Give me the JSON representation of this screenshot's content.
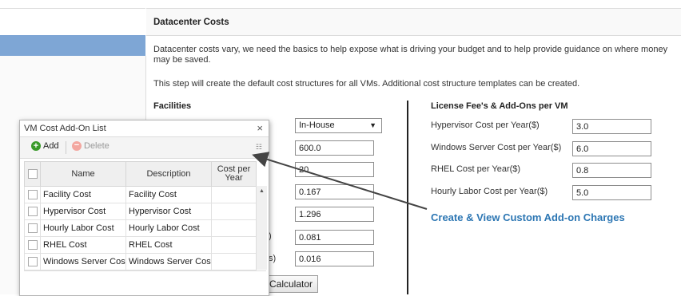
{
  "page": {
    "title": "Datacenter Costs",
    "intro_1": "Datacenter costs vary, we need the basics to help expose what is driving your budget and to help provide guidance on where money may be saved.",
    "intro_2": "This step will create the default cost structures for all VMs. Additional cost structure templates can be created."
  },
  "facilities": {
    "heading": "Facilities",
    "select_value": "In-House",
    "values": [
      "600.0",
      "20",
      "0.167",
      "1.296",
      "0.081",
      "0.016"
    ],
    "partial_label_1": ")",
    "partial_label_2": "s)",
    "calculator_label": "Calculator"
  },
  "license": {
    "heading": "License Fee's & Add-Ons per VM",
    "rows": [
      {
        "label": "Hypervisor Cost per Year($)",
        "value": "3.0"
      },
      {
        "label": "Windows Server Cost per Year($)",
        "value": "6.0"
      },
      {
        "label": "RHEL Cost per Year($)",
        "value": "0.8"
      },
      {
        "label": "Hourly Labor Cost per Year($)",
        "value": "5.0"
      }
    ],
    "link_text": "Create & View Custom Add-on Charges"
  },
  "popup": {
    "title": "VM Cost Add-On List",
    "close": "×",
    "add_label": "Add",
    "delete_label": "Delete",
    "columns": [
      "Name",
      "Description",
      "Cost per Year"
    ],
    "rows": [
      {
        "name": "Facility Cost",
        "description": "Facility Cost"
      },
      {
        "name": "Hypervisor Cost",
        "description": "Hypervisor Cost"
      },
      {
        "name": "Hourly Labor Cost",
        "description": "Hourly Labor Cost"
      },
      {
        "name": "RHEL Cost",
        "description": "RHEL Cost"
      },
      {
        "name": "Windows Server Cost",
        "description": "Windows Server Cost"
      }
    ]
  },
  "colors": {
    "link": "#2c76b3",
    "sidebar_selected": "#7ea6d5",
    "add_icon": "#3a9a2a"
  },
  "icons": {
    "add": "add-circle-icon",
    "delete": "delete-circle-icon",
    "close": "close-icon",
    "menu": "grid-menu-icon",
    "dropdown": "chevron-down-icon"
  }
}
